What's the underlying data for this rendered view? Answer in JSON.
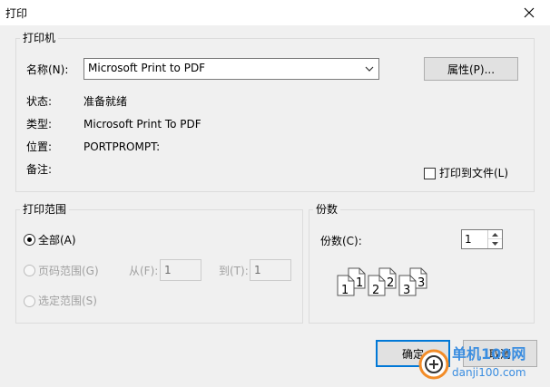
{
  "window": {
    "title": "打印"
  },
  "printer_group": {
    "legend": "打印机",
    "name_label": "名称(N):",
    "name_value": "Microsoft Print to PDF",
    "properties_button": "属性(P)...",
    "status_label": "状态:",
    "status_value": "准备就绪",
    "type_label": "类型:",
    "type_value": "Microsoft Print To PDF",
    "where_label": "位置:",
    "where_value": "PORTPROMPT:",
    "comment_label": "备注:",
    "print_to_file_label": "打印到文件(L)"
  },
  "range_group": {
    "legend": "打印范围",
    "all_label": "全部(A)",
    "pages_label": "页码范围(G)",
    "from_label": "从(F):",
    "from_value": "1",
    "to_label": "到(T):",
    "to_value": "1",
    "selection_label": "选定范围(S)"
  },
  "copies_group": {
    "legend": "份数",
    "copies_label": "份数(C):",
    "copies_value": "1",
    "collate_page_labels": [
      "1",
      "1",
      "2",
      "2",
      "3",
      "3"
    ]
  },
  "footer": {
    "ok_button": "确定",
    "cancel_button": "取消"
  },
  "watermark": {
    "title": "单机100网",
    "url": "danji100.com"
  }
}
